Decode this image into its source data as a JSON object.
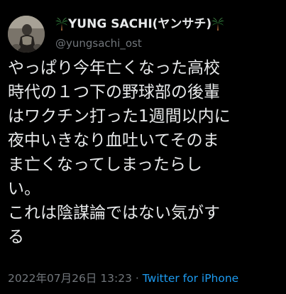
{
  "tweet": {
    "display_name": "YUNG SACHI(ヤンサチ)",
    "name_emoji_left": "palm-tree-icon",
    "name_emoji_right": "palm-tree-icon",
    "handle": "@yungsachi_ost",
    "body": "やっぱり今年亡くなった高校\n時代の１つ下の野球部の後輩\nはワクチン打った1週間以内に\n夜中いきなり血吐いてそのま\nま亡くなってしまったらし\nい。\nこれは陰謀論ではない気がす\nる",
    "timestamp": "2022年07月26日 13:23",
    "separator": " · ",
    "source": "Twitter for iPhone"
  },
  "colors": {
    "background": "#000000",
    "text": "#e7e9ea",
    "muted": "#71767b",
    "link": "#1d9bf0"
  }
}
